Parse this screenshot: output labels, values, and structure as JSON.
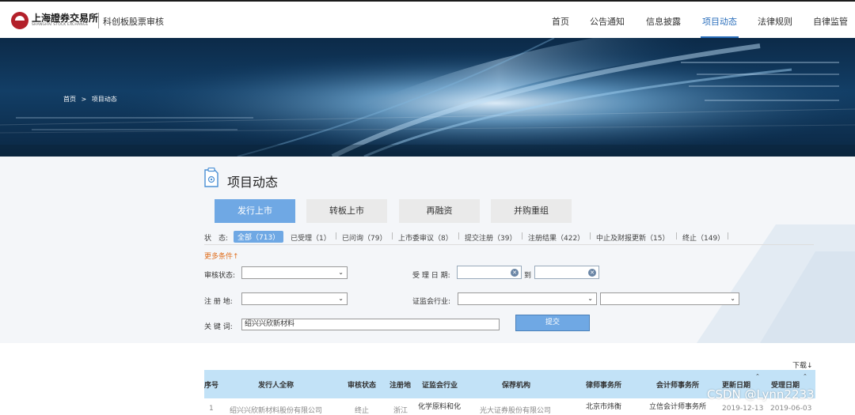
{
  "header": {
    "logo_name": "上海證券交易所",
    "logo_en": "SHANGHAI STOCK EXCHANGE",
    "subtitle": "科创板股票审核",
    "nav": [
      "首页",
      "公告通知",
      "信息披露",
      "项目动态",
      "法律规则",
      "自律监管"
    ],
    "active_nav": "项目动态"
  },
  "breadcrumb": {
    "home": "首页",
    "separator": ">",
    "current": "项目动态"
  },
  "page": {
    "title": "项目动态",
    "tabs": [
      "发行上市",
      "转板上市",
      "再融资",
      "并购重组"
    ],
    "active_tab": "发行上市"
  },
  "status_filter": {
    "label": "状　态:",
    "items": [
      {
        "label": "全部（713）",
        "active": true
      },
      {
        "label": "已受理（1）",
        "active": false
      },
      {
        "label": "已问询（79）",
        "active": false
      },
      {
        "label": "上市委审议（8）",
        "active": false
      },
      {
        "label": "提交注册（39）",
        "active": false
      },
      {
        "label": "注册结果（422）",
        "active": false
      },
      {
        "label": "中止及财报更新（15）",
        "active": false
      },
      {
        "label": "终止（149）",
        "active": false
      }
    ]
  },
  "more_conditions": "更多条件↑",
  "filters": {
    "review_status_label": "审核状态:",
    "accept_date_label": "受 理 日 期:",
    "date_to": "到",
    "reg_place_label": "注 册 地:",
    "industry_label": "证监会行业:",
    "keyword_label": "关 键 词:",
    "keyword_value": "绍兴兴欣新材料",
    "submit": "提交"
  },
  "table": {
    "download": "下载↓",
    "headers": [
      "序号",
      "发行人全称",
      "审核状态",
      "注册地",
      "证监会行业",
      "保荐机构",
      "律师事务所",
      "会计师事务所",
      "更新日期",
      "受理日期"
    ],
    "rows": [
      [
        "1",
        "绍兴兴欣新材料股份有限公司",
        "终止",
        "浙江",
        "化学原料和化",
        "光大证券股份有限公司",
        "北京市炜衡",
        "立信会计师事务所",
        "2019-12-13",
        "2019-06-03"
      ]
    ]
  },
  "watermark": "CSDN @Lynn2233",
  "colors": {
    "accent": "#6fa8e4",
    "nav_active": "#2a6ebb",
    "table_header": "#c2e2f7",
    "more_link": "#e07020"
  }
}
